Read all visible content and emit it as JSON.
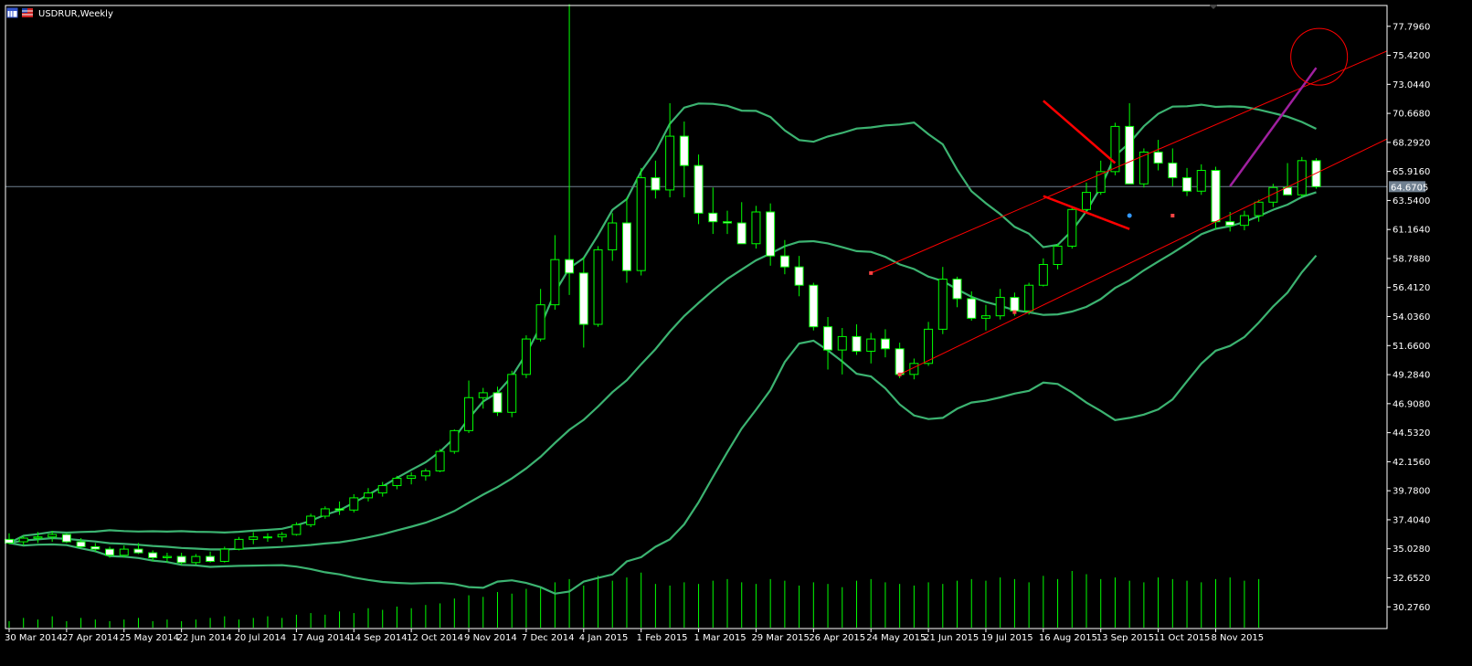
{
  "window": {
    "title": "USDRUR,Weekly",
    "icons": [
      "chart-window-icon",
      "flag-icon"
    ]
  },
  "colors": {
    "background": "#000000",
    "axis": "#ffffff",
    "bull_body": "#000000",
    "bear_body": "#ffffff",
    "wick": "#00ff00",
    "volume": "#00ff00",
    "bollinger": "#3cb371",
    "bid_line": "#708090",
    "trendline": "#ff0000",
    "arrow": "#a020a0",
    "target_circle": "#ff0000"
  },
  "chart_data": {
    "type": "candlestick",
    "symbol": "USDRUR",
    "timeframe": "Weekly",
    "ylim": [
      28.5,
      79.5
    ],
    "y_ticks": [
      "77.7960",
      "75.4200",
      "73.0440",
      "70.6680",
      "68.2920",
      "65.9160",
      "63.5400",
      "61.1640",
      "58.7880",
      "56.4120",
      "54.0360",
      "51.6600",
      "49.2840",
      "46.9080",
      "44.5320",
      "42.1560",
      "39.7800",
      "37.4040",
      "35.0280",
      "32.6520",
      "30.2760"
    ],
    "x_ticks": [
      {
        "i": 0,
        "label": "30 Mar 2014"
      },
      {
        "i": 4,
        "label": "27 Apr 2014"
      },
      {
        "i": 8,
        "label": "25 May 2014"
      },
      {
        "i": 12,
        "label": "22 Jun 2014"
      },
      {
        "i": 16,
        "label": "20 Jul 2014"
      },
      {
        "i": 20,
        "label": "17 Aug 2014"
      },
      {
        "i": 24,
        "label": "14 Sep 2014"
      },
      {
        "i": 28,
        "label": "12 Oct 2014"
      },
      {
        "i": 32,
        "label": "9 Nov 2014"
      },
      {
        "i": 36,
        "label": "7 Dec 2014"
      },
      {
        "i": 40,
        "label": "4 Jan 2015"
      },
      {
        "i": 44,
        "label": "1 Feb 2015"
      },
      {
        "i": 48,
        "label": "1 Mar 2015"
      },
      {
        "i": 52,
        "label": "29 Mar 2015"
      },
      {
        "i": 56,
        "label": "26 Apr 2015"
      },
      {
        "i": 60,
        "label": "24 May 2015"
      },
      {
        "i": 64,
        "label": "21 Jun 2015"
      },
      {
        "i": 68,
        "label": "19 Jul 2015"
      },
      {
        "i": 72,
        "label": "16 Aug 2015"
      },
      {
        "i": 76,
        "label": "13 Sep 2015"
      },
      {
        "i": 80,
        "label": "11 Oct 2015"
      },
      {
        "i": 84,
        "label": "8 Nov 2015"
      }
    ],
    "current_price": "64.6705",
    "current_price_value": 64.6705,
    "ohlc": [
      [
        35.8,
        36.3,
        35.4,
        35.5
      ],
      [
        35.6,
        36.1,
        35.3,
        35.9
      ],
      [
        35.9,
        36.4,
        35.5,
        36.0
      ],
      [
        36.0,
        36.5,
        35.6,
        36.2
      ],
      [
        36.2,
        36.3,
        35.5,
        35.6
      ],
      [
        35.6,
        35.9,
        35.1,
        35.2
      ],
      [
        35.2,
        35.5,
        34.8,
        35.0
      ],
      [
        35.0,
        35.2,
        34.3,
        34.5
      ],
      [
        34.5,
        35.3,
        34.3,
        35.0
      ],
      [
        35.0,
        35.5,
        34.6,
        34.7
      ],
      [
        34.7,
        34.9,
        34.0,
        34.3
      ],
      [
        34.3,
        34.7,
        33.9,
        34.4
      ],
      [
        34.4,
        34.7,
        33.7,
        33.9
      ],
      [
        33.9,
        34.6,
        33.7,
        34.4
      ],
      [
        34.4,
        34.8,
        33.9,
        34.0
      ],
      [
        34.0,
        35.2,
        33.9,
        35.0
      ],
      [
        35.0,
        36.0,
        34.9,
        35.8
      ],
      [
        35.8,
        36.4,
        35.4,
        36.0
      ],
      [
        36.0,
        36.3,
        35.6,
        36.0
      ],
      [
        36.0,
        36.4,
        35.6,
        36.2
      ],
      [
        36.2,
        37.2,
        36.1,
        37.0
      ],
      [
        37.0,
        37.9,
        36.8,
        37.7
      ],
      [
        37.7,
        38.5,
        37.5,
        38.3
      ],
      [
        38.3,
        38.9,
        37.8,
        38.2
      ],
      [
        38.2,
        39.5,
        38.0,
        39.2
      ],
      [
        39.2,
        40.0,
        38.9,
        39.6
      ],
      [
        39.6,
        40.5,
        39.3,
        40.2
      ],
      [
        40.2,
        41.0,
        39.9,
        40.8
      ],
      [
        40.8,
        41.3,
        40.3,
        41.0
      ],
      [
        41.0,
        41.6,
        40.6,
        41.4
      ],
      [
        41.4,
        43.2,
        41.3,
        43.0
      ],
      [
        43.0,
        44.8,
        42.8,
        44.7
      ],
      [
        44.7,
        48.8,
        44.5,
        47.4
      ],
      [
        47.4,
        48.2,
        46.5,
        47.8
      ],
      [
        47.8,
        48.3,
        45.9,
        46.2
      ],
      [
        46.2,
        49.6,
        45.8,
        49.3
      ],
      [
        49.3,
        52.5,
        49.0,
        52.2
      ],
      [
        52.2,
        56.3,
        52.0,
        55.0
      ],
      [
        55.0,
        60.7,
        54.6,
        58.7
      ],
      [
        58.7,
        79.6,
        55.8,
        57.6
      ],
      [
        57.6,
        58.9,
        51.5,
        53.4
      ],
      [
        53.4,
        59.8,
        53.2,
        59.5
      ],
      [
        59.5,
        62.5,
        58.6,
        61.7
      ],
      [
        61.7,
        63.8,
        56.8,
        57.8
      ],
      [
        57.8,
        66.2,
        57.4,
        65.4
      ],
      [
        65.4,
        66.8,
        63.7,
        64.4
      ],
      [
        64.4,
        71.5,
        63.8,
        68.8
      ],
      [
        68.8,
        70.0,
        63.8,
        66.4
      ],
      [
        66.4,
        67.3,
        61.6,
        62.5
      ],
      [
        62.5,
        64.6,
        60.8,
        61.8
      ],
      [
        61.8,
        62.7,
        60.8,
        61.7
      ],
      [
        61.7,
        63.4,
        60.0,
        60.0
      ],
      [
        60.0,
        63.1,
        59.6,
        62.6
      ],
      [
        62.6,
        63.3,
        58.2,
        59.0
      ],
      [
        59.0,
        60.3,
        57.5,
        58.1
      ],
      [
        58.1,
        59.0,
        55.7,
        56.6
      ],
      [
        56.6,
        56.8,
        52.9,
        53.2
      ],
      [
        53.2,
        54.0,
        49.7,
        51.3
      ],
      [
        51.3,
        53.1,
        49.3,
        52.4
      ],
      [
        52.4,
        53.4,
        50.9,
        51.2
      ],
      [
        51.2,
        52.7,
        50.2,
        52.2
      ],
      [
        52.2,
        53.0,
        50.7,
        51.4
      ],
      [
        51.4,
        51.9,
        49.0,
        49.3
      ],
      [
        49.3,
        50.6,
        48.9,
        50.2
      ],
      [
        50.2,
        53.6,
        50.0,
        53.0
      ],
      [
        53.0,
        58.1,
        52.6,
        57.1
      ],
      [
        57.1,
        57.3,
        54.8,
        55.5
      ],
      [
        55.5,
        56.1,
        53.7,
        53.9
      ],
      [
        53.9,
        55.0,
        52.9,
        54.1
      ],
      [
        54.1,
        56.3,
        53.8,
        55.6
      ],
      [
        55.6,
        56.0,
        54.1,
        54.5
      ],
      [
        54.5,
        56.8,
        54.2,
        56.6
      ],
      [
        56.6,
        58.8,
        56.5,
        58.3
      ],
      [
        58.3,
        60.0,
        57.9,
        59.8
      ],
      [
        59.8,
        63.0,
        59.6,
        62.8
      ],
      [
        62.8,
        65.0,
        62.5,
        64.2
      ],
      [
        64.2,
        66.8,
        64.0,
        65.9
      ],
      [
        65.9,
        69.9,
        65.6,
        69.6
      ],
      [
        69.6,
        71.5,
        65.0,
        64.9
      ],
      [
        64.9,
        67.8,
        64.6,
        67.5
      ],
      [
        67.5,
        68.5,
        66.0,
        66.6
      ],
      [
        66.6,
        67.8,
        64.7,
        65.4
      ],
      [
        65.4,
        66.2,
        63.9,
        64.3
      ],
      [
        64.3,
        66.5,
        64.0,
        66.0
      ],
      [
        66.0,
        66.3,
        61.2,
        61.8
      ],
      [
        61.8,
        62.6,
        61.0,
        61.5
      ],
      [
        61.5,
        62.7,
        61.1,
        62.3
      ],
      [
        62.3,
        63.6,
        61.8,
        63.4
      ],
      [
        63.4,
        64.9,
        63.0,
        64.6
      ],
      [
        64.6,
        66.6,
        64.5,
        64.0
      ],
      [
        64.0,
        67.1,
        63.8,
        66.8
      ],
      [
        66.8,
        67.0,
        64.5,
        64.67
      ]
    ],
    "volume": [
      4,
      6,
      5,
      7,
      4,
      6,
      5,
      4,
      5,
      6,
      4,
      5,
      4,
      5,
      6,
      7,
      5,
      6,
      7,
      6,
      8,
      9,
      8,
      10,
      9,
      12,
      11,
      13,
      12,
      14,
      15,
      18,
      20,
      19,
      22,
      21,
      24,
      25,
      28,
      30,
      26,
      32,
      29,
      31,
      34,
      27,
      26,
      28,
      27,
      29,
      30,
      28,
      27,
      30,
      29,
      26,
      28,
      27,
      25,
      29,
      30,
      28,
      27,
      26,
      28,
      27,
      29,
      30,
      29,
      31,
      30,
      28,
      32,
      30,
      35,
      33,
      30,
      31,
      29,
      28,
      31,
      30,
      29,
      28,
      30,
      31,
      29,
      30
    ],
    "bollinger_period": 20,
    "bollinger_deviations": 2
  }
}
